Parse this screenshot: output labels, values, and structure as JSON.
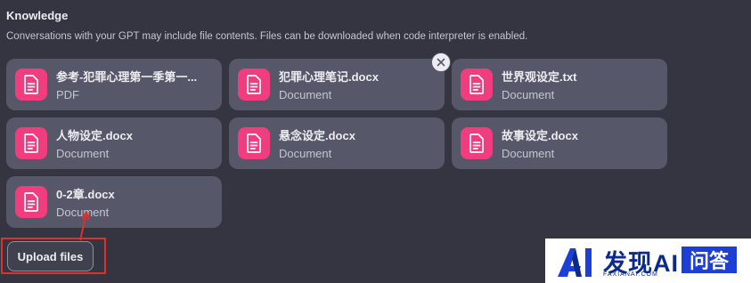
{
  "knowledge": {
    "title": "Knowledge",
    "description": "Conversations with your GPT may include file contents. Files can be downloaded when code interpreter is enabled."
  },
  "files": [
    {
      "name": "参考-犯罪心理第一季第一...",
      "type": "PDF",
      "icon": "document-icon"
    },
    {
      "name": "犯罪心理笔记.docx",
      "type": "Document",
      "icon": "document-icon",
      "hovered": true
    },
    {
      "name": "世界观设定.txt",
      "type": "Document",
      "icon": "document-icon"
    },
    {
      "name": "人物设定.docx",
      "type": "Document",
      "icon": "document-icon"
    },
    {
      "name": "悬念设定.docx",
      "type": "Document",
      "icon": "document-icon"
    },
    {
      "name": "故事设定.docx",
      "type": "Document",
      "icon": "document-icon"
    },
    {
      "name": "0-2章.docx",
      "type": "Document",
      "icon": "document-icon"
    }
  ],
  "upload_button": {
    "label": "Upload files"
  },
  "annotation": {
    "highlight_color": "#e0302a"
  },
  "watermark": {
    "brand": "发现AI",
    "sub": "FAXIANAI.COM",
    "qa": "问答"
  },
  "colors": {
    "background": "#343541",
    "card": "#565869",
    "file_icon": "#f03d7d"
  }
}
